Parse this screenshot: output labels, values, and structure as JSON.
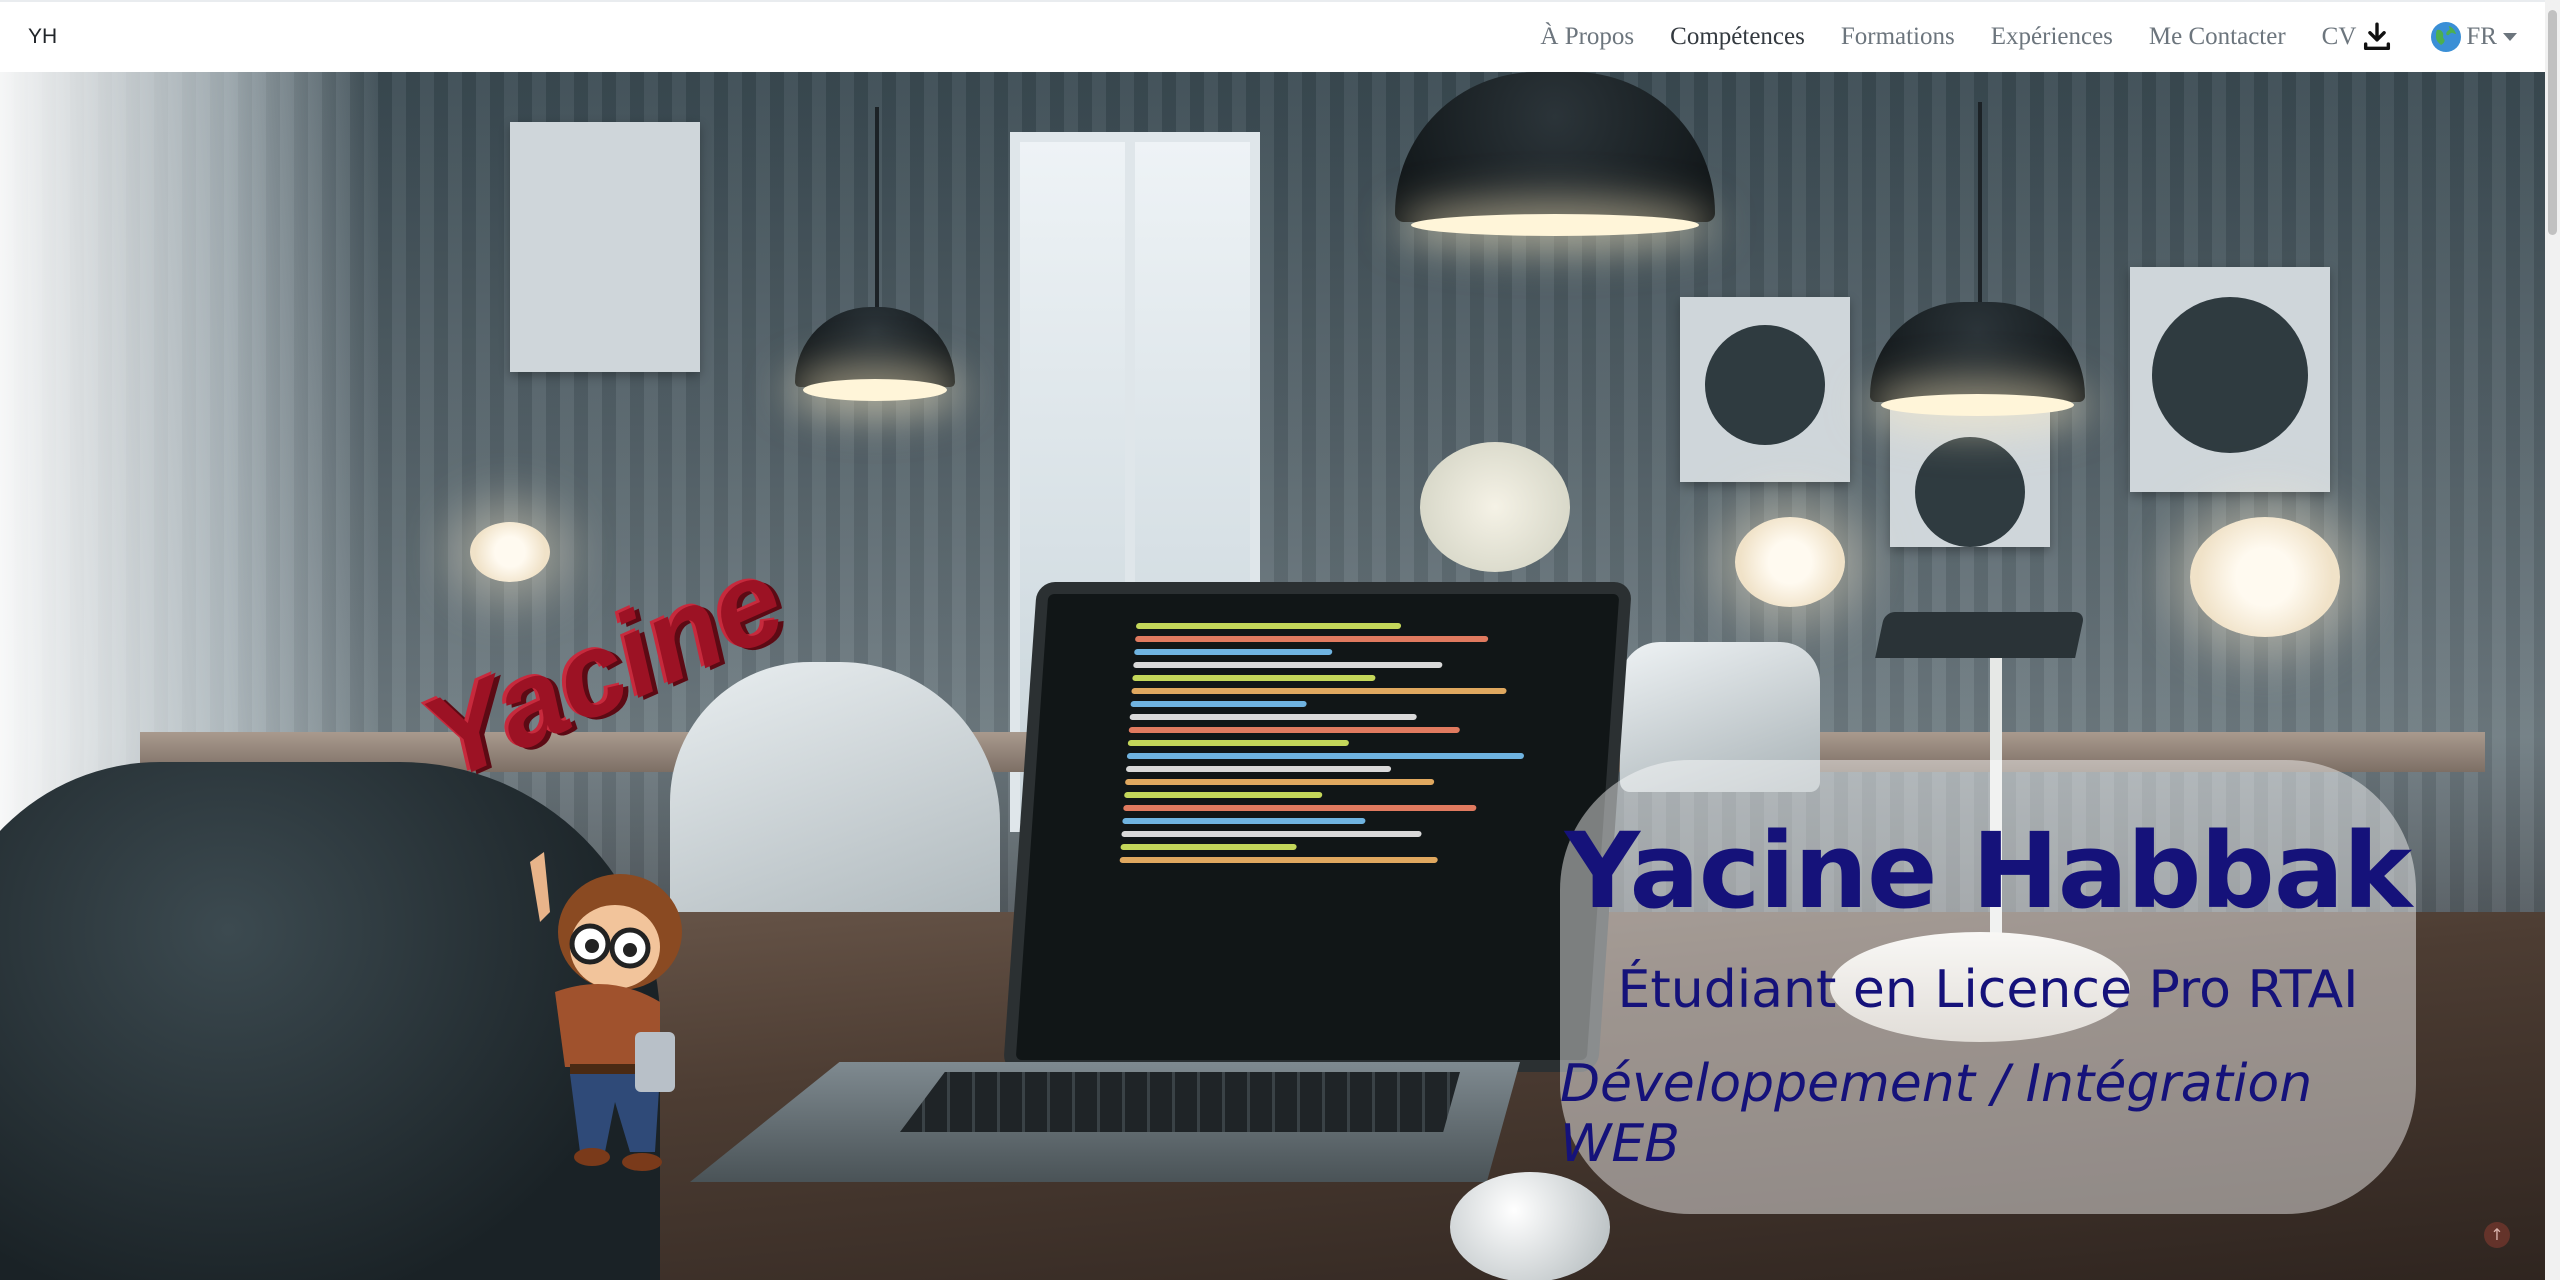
{
  "navbar": {
    "brand": "YH",
    "links": [
      "À Propos",
      "Compétences",
      "Formations",
      "Expériences",
      "Me Contacter"
    ],
    "active_link": "Compétences",
    "cv_label": "CV",
    "cv_icon": "download-icon",
    "language": "FR",
    "language_icon": "globe-icon"
  },
  "hero": {
    "mascot_name": "Yacine",
    "name": "Yacine Habbak",
    "subtitle": "Étudiant en Licence Pro RTAI",
    "role": "Développement / Intégration WEB"
  },
  "scroll_top_icon": "arrow-up-icon",
  "colors": {
    "hero_text": "#15127a",
    "mascot_text": "#9c1224",
    "nav_text": "#6c757d",
    "nav_active": "#343a40"
  }
}
